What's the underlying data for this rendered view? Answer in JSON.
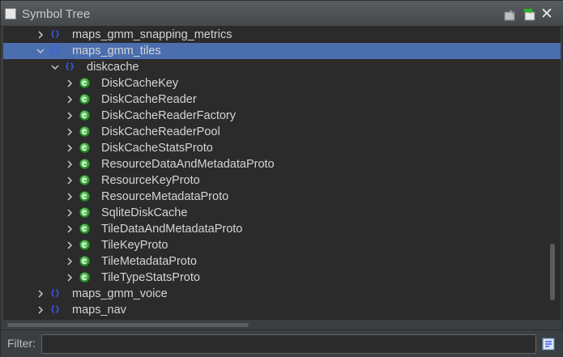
{
  "window": {
    "title": "Symbol Tree"
  },
  "tree": {
    "rows": [
      {
        "label": "maps_gmm_snapping_metrics",
        "kind": "namespace",
        "depth": 0,
        "expanded": false,
        "selected": false
      },
      {
        "label": "maps_gmm_tiles",
        "kind": "namespace",
        "depth": 0,
        "expanded": true,
        "selected": true
      },
      {
        "label": "diskcache",
        "kind": "namespace",
        "depth": 1,
        "expanded": true,
        "selected": false
      },
      {
        "label": "DiskCacheKey",
        "kind": "class",
        "depth": 2,
        "expanded": false,
        "selected": false
      },
      {
        "label": "DiskCacheReader",
        "kind": "class",
        "depth": 2,
        "expanded": false,
        "selected": false
      },
      {
        "label": "DiskCacheReaderFactory",
        "kind": "class",
        "depth": 2,
        "expanded": false,
        "selected": false
      },
      {
        "label": "DiskCacheReaderPool",
        "kind": "class",
        "depth": 2,
        "expanded": false,
        "selected": false
      },
      {
        "label": "DiskCacheStatsProto",
        "kind": "class",
        "depth": 2,
        "expanded": false,
        "selected": false
      },
      {
        "label": "ResourceDataAndMetadataProto",
        "kind": "class",
        "depth": 2,
        "expanded": false,
        "selected": false
      },
      {
        "label": "ResourceKeyProto",
        "kind": "class",
        "depth": 2,
        "expanded": false,
        "selected": false
      },
      {
        "label": "ResourceMetadataProto",
        "kind": "class",
        "depth": 2,
        "expanded": false,
        "selected": false
      },
      {
        "label": "SqliteDiskCache",
        "kind": "class",
        "depth": 2,
        "expanded": false,
        "selected": false
      },
      {
        "label": "TileDataAndMetadataProto",
        "kind": "class",
        "depth": 2,
        "expanded": false,
        "selected": false
      },
      {
        "label": "TileKeyProto",
        "kind": "class",
        "depth": 2,
        "expanded": false,
        "selected": false
      },
      {
        "label": "TileMetadataProto",
        "kind": "class",
        "depth": 2,
        "expanded": false,
        "selected": false
      },
      {
        "label": "TileTypeStatsProto",
        "kind": "class",
        "depth": 2,
        "expanded": false,
        "selected": false
      },
      {
        "label": "maps_gmm_voice",
        "kind": "namespace",
        "depth": 0,
        "expanded": false,
        "selected": false
      },
      {
        "label": "maps_nav",
        "kind": "namespace",
        "depth": 0,
        "expanded": false,
        "selected": false
      }
    ]
  },
  "icons": {
    "namespace": "namespace-icon",
    "class": "class-icon",
    "snapshot": "snapshot-icon",
    "refresh": "refresh-icon",
    "close": "close-icon",
    "filter_clear": "filter-options-icon"
  },
  "colors": {
    "selection": "#4b6eaf",
    "tree_background": "#2b2b2b",
    "panel_background": "#3c3f41",
    "namespace_icon": "#3a5bff",
    "class_icon": "#2e9a2e"
  },
  "filter": {
    "label": "Filter:",
    "value": "",
    "placeholder": ""
  },
  "close_glyph": "✕"
}
